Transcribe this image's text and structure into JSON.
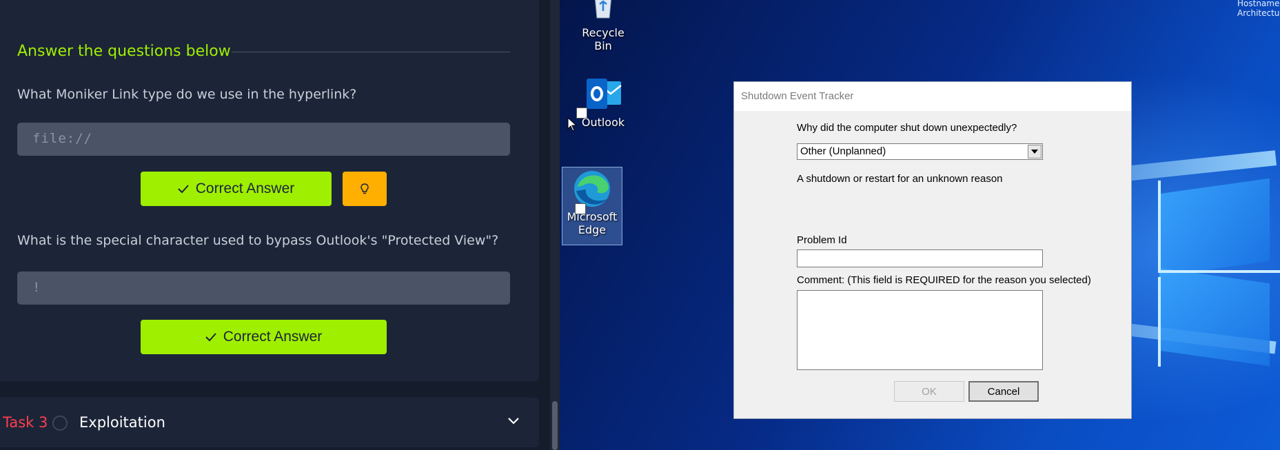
{
  "left_panel": {
    "section_title": "Answer the questions below",
    "questions": [
      {
        "text": "What Moniker Link type do we use in the hyperlink?",
        "answer": "file://",
        "button_label": "Correct Answer",
        "has_hint": true
      },
      {
        "text": "What is the special character used to bypass Outlook's \"Protected View\"?",
        "answer": "!",
        "button_label": "Correct Answer",
        "has_hint": false
      }
    ],
    "task": {
      "number": "Task 3",
      "name": "Exploitation"
    }
  },
  "desktop": {
    "corner_text": [
      "Hostname",
      "Architectu"
    ],
    "icons": [
      {
        "label": "Recycle Bin",
        "icon": "recycle-bin-icon"
      },
      {
        "label": "Outlook",
        "icon": "outlook-icon"
      },
      {
        "label_line1": "Microsoft",
        "label_line2": "Edge",
        "icon": "edge-icon",
        "selected": true
      }
    ]
  },
  "dialog": {
    "title": "Shutdown Event Tracker",
    "question": "Why did the computer shut down unexpectedly?",
    "reason_selected": "Other (Unplanned)",
    "reason_description": "A shutdown or restart for an unknown reason",
    "problem_id_label": "Problem Id",
    "problem_id_value": "",
    "comment_label": "Comment: (This field is REQUIRED for the reason you selected)",
    "comment_value": "",
    "ok_label": "OK",
    "cancel_label": "Cancel"
  },
  "colors": {
    "accent": "#9fef00",
    "hint": "#ffaf00",
    "task_red": "#ff3e4d",
    "panel_bg": "#1c2538"
  }
}
